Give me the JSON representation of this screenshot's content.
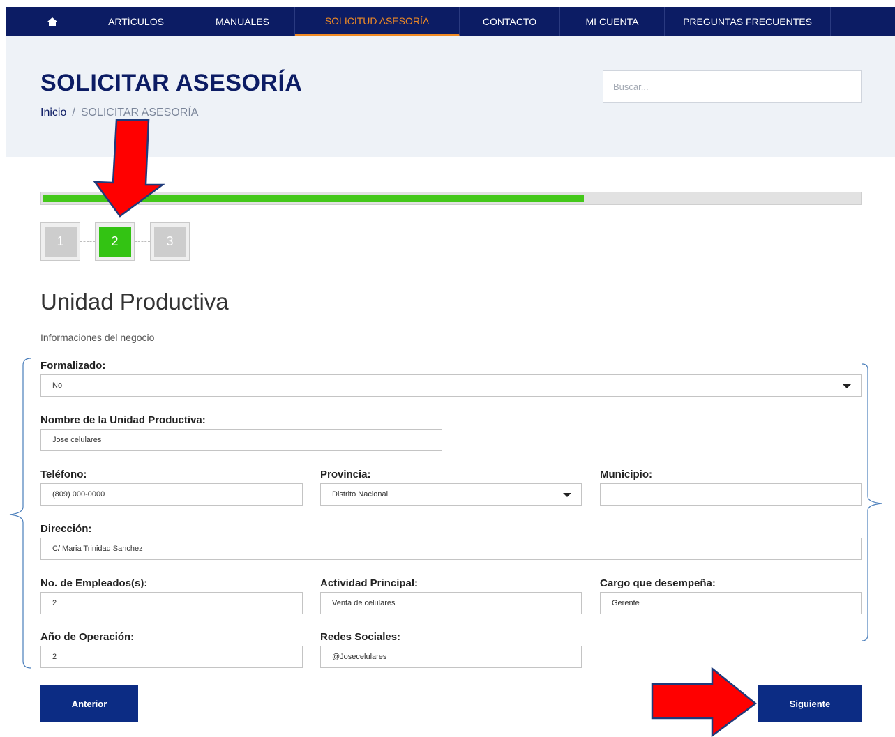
{
  "nav": {
    "items": [
      {
        "label": "ARTÍCULOS"
      },
      {
        "label": "MANUALES"
      },
      {
        "label": "SOLICITUD ASESORÍA"
      },
      {
        "label": "CONTACTO"
      },
      {
        "label": "MI CUENTA"
      },
      {
        "label": "PREGUNTAS FRECUENTES"
      }
    ],
    "active_color": "#f08a24",
    "background": "#0c1c64"
  },
  "header": {
    "title": "SOLICITAR ASESORÍA",
    "breadcrumb_home": "Inicio",
    "breadcrumb_sep": "/",
    "breadcrumb_current": "SOLICITAR ASESORÍA",
    "search_placeholder": "Buscar..."
  },
  "wizard": {
    "progress_fraction": 0.665,
    "steps": [
      "1",
      "2",
      "3"
    ],
    "active_step": 2,
    "progress_color": "#44c81a"
  },
  "form": {
    "title": "Unidad Productiva",
    "subtitle": "Informaciones del negocio",
    "formalizado_label": "Formalizado:",
    "formalizado_value": "No",
    "nombre_label": "Nombre de la Unidad Productiva:",
    "nombre_value": "Jose celulares",
    "telefono_label": "Teléfono:",
    "telefono_value": "(809) 000-0000",
    "provincia_label": "Provincia:",
    "provincia_value": "Distrito Nacional",
    "municipio_label": "Municipio:",
    "municipio_value": "",
    "direccion_label": "Dirección:",
    "direccion_value": "C/ Maria Trinidad Sanchez",
    "empleados_label": "No. de Empleados(s):",
    "empleados_value": "2",
    "actividad_label": "Actividad Principal:",
    "actividad_value": "Venta de celulares",
    "cargo_label": "Cargo que desempeña:",
    "cargo_value": "Gerente",
    "anio_label": "Año de Operación:",
    "anio_value": "2",
    "redes_label": "Redes Sociales:",
    "redes_value": "@Josecelulares"
  },
  "buttons": {
    "prev": "Anterior",
    "next": "Siguiente",
    "color": "#0c2c84"
  },
  "annotations": {
    "arrow_color": "#ff0000",
    "bracket_color": "#4a7ebb"
  }
}
